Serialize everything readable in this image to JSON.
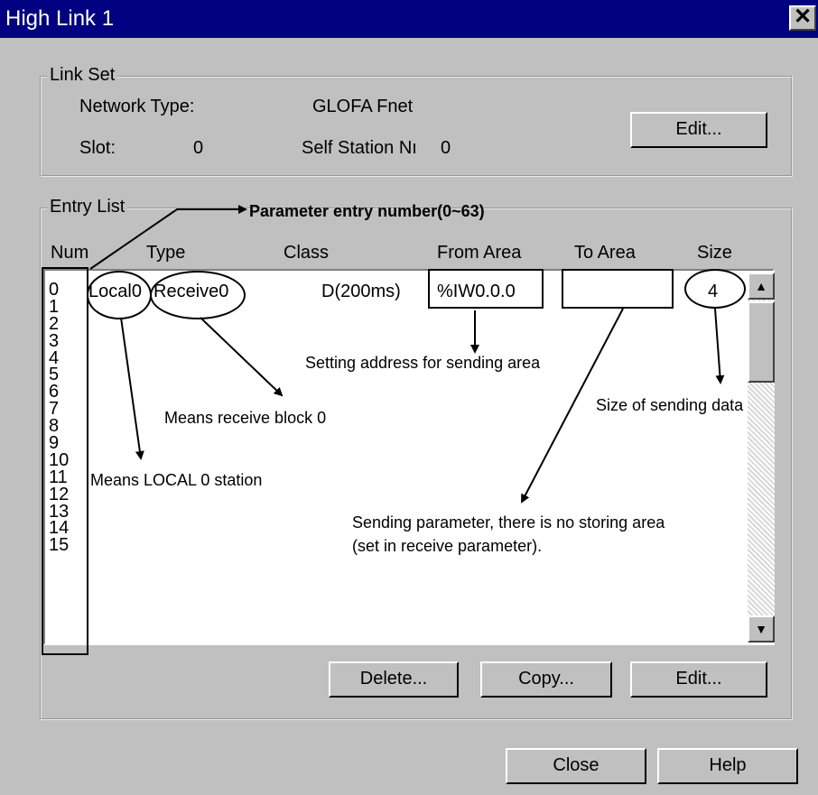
{
  "window": {
    "title": "High Link 1",
    "close_glyph": "✕"
  },
  "link_set": {
    "group_label": "Link Set",
    "network_type_label": "Network Type:",
    "network_type_value": "GLOFA Fnet",
    "slot_label": "Slot:",
    "slot_value": "0",
    "self_station_label": "Self Station Nı",
    "self_station_value": "0",
    "edit_label": "Edit..."
  },
  "entry_list": {
    "group_label": "Entry List",
    "columns": [
      "Num",
      "Type",
      "Class",
      "From Area",
      "To Area",
      "Size"
    ],
    "row0": {
      "num": "0",
      "station": "Local0",
      "type": "Receive0",
      "class": "D(200ms)",
      "from_area": "%IW0.0.0",
      "to_area": "",
      "size": "4"
    },
    "numbers": [
      "0",
      "1",
      "2",
      "3",
      "4",
      "5",
      "6",
      "7",
      "8",
      "9",
      "10",
      "11",
      "12",
      "13",
      "14",
      "15"
    ],
    "delete_label": "Delete...",
    "copy_label": "Copy...",
    "edit_label": "Edit..."
  },
  "buttons": {
    "close_label": "Close",
    "help_label": "Help"
  },
  "scrollbar": {
    "up_icon": "scroll-up-arrow",
    "down_icon": "scroll-down-arrow"
  },
  "annotations": {
    "entry_number": "Parameter entry number(0~63)",
    "sending_address": "Setting address for sending area",
    "receive_block": "Means receive block 0",
    "sending_size": "Size of sending data",
    "local_station": "Means LOCAL 0 station",
    "no_storing_1": "Sending parameter, there is no storing area",
    "no_storing_2": "(set in receive parameter)."
  }
}
